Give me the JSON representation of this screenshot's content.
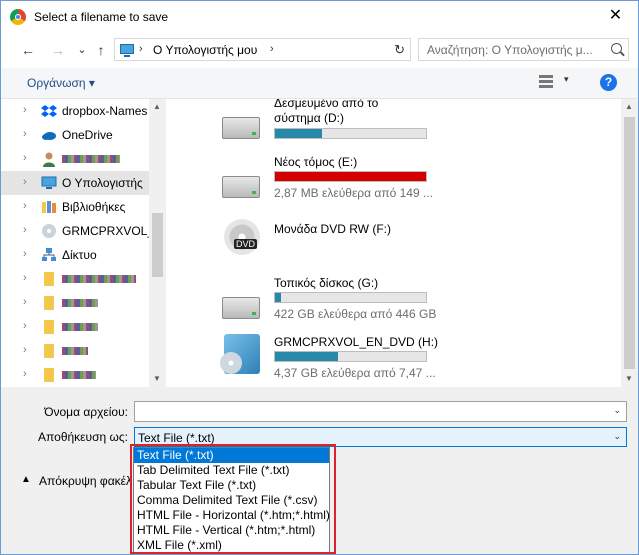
{
  "window": {
    "title": "Select a filename to save",
    "close_glyph": "✕"
  },
  "nav": {
    "back": "←",
    "forward": "→",
    "recent": "⌄",
    "up": "↑"
  },
  "address": {
    "sep1": "›",
    "location": "Ο Υπολογιστής μου",
    "sep2": "›",
    "refresh": "↻"
  },
  "search": {
    "placeholder": "Αναζήτηση: Ο Υπολογιστής μ..."
  },
  "toolbar": {
    "organize": "Οργάνωση ▾",
    "view_arrow": "▾",
    "help": "?"
  },
  "nav_pane": {
    "items": [
      {
        "label": "dropbox-Names",
        "icon": "dropbox-icon"
      },
      {
        "label": "OneDrive",
        "icon": "onedrive-icon"
      },
      {
        "label": "",
        "icon": "user-icon"
      },
      {
        "label": "Ο Υπολογιστής",
        "icon": "computer-icon",
        "selected": true
      },
      {
        "label": "Βιβλιοθήκες",
        "icon": "libraries-icon"
      },
      {
        "label": "GRMCPRXVOL_E",
        "icon": "disc-icon"
      },
      {
        "label": "Δίκτυο",
        "icon": "network-icon"
      },
      {
        "label": "",
        "icon": "folder-icon"
      },
      {
        "label": "",
        "icon": "folder-icon"
      },
      {
        "label": "",
        "icon": "folder-icon"
      },
      {
        "label": "",
        "icon": "folder-icon"
      },
      {
        "label": "",
        "icon": "folder-icon"
      }
    ]
  },
  "drives": [
    {
      "name": "Δεσμευμένο από το",
      "name2": "σύστημα (D:)",
      "fill": 0.31,
      "color": "#2789a8",
      "info": ""
    },
    {
      "name": "Νέος τόμος (E:)",
      "fill": 1.0,
      "color": "#d40000",
      "info": "2,87 MB ελεύθερα από 149 ..."
    },
    {
      "name": "Μονάδα DVD RW (F:)",
      "fill": 0,
      "color": "",
      "info": "",
      "badge": "DVD"
    },
    {
      "name": "Τοπικός δίσκος (G:)",
      "fill": 0.04,
      "color": "#2789a8",
      "info": "422 GB ελεύθερα από 446 GB"
    },
    {
      "name": "GRMCPRXVOL_EN_DVD (H:)",
      "fill": 0.42,
      "color": "#2789a8",
      "info": "4,37 GB ελεύθερα από 7,47 ..."
    }
  ],
  "form": {
    "filename_label": "Όνομα αρχείου:",
    "filename_value": "",
    "saveas_label": "Αποθήκευση ως:",
    "saveas_value": "Text File (*.txt)",
    "hide_folders": "Απόκρυψη φακέλ",
    "combo_arrow": "⌄"
  },
  "dropdown": {
    "options": [
      "Text File (*.txt)",
      "Tab Delimited Text File (*.txt)",
      "Tabular Text File (*.txt)",
      "Comma Delimited Text File (*.csv)",
      "HTML File - Horizontal (*.htm;*.html)",
      "HTML File - Vertical (*.htm;*.html)",
      "XML File (*.xml)"
    ],
    "selected_index": 0
  },
  "colors": {
    "highlight_box": "#d9232d",
    "selection": "#0078d7"
  }
}
